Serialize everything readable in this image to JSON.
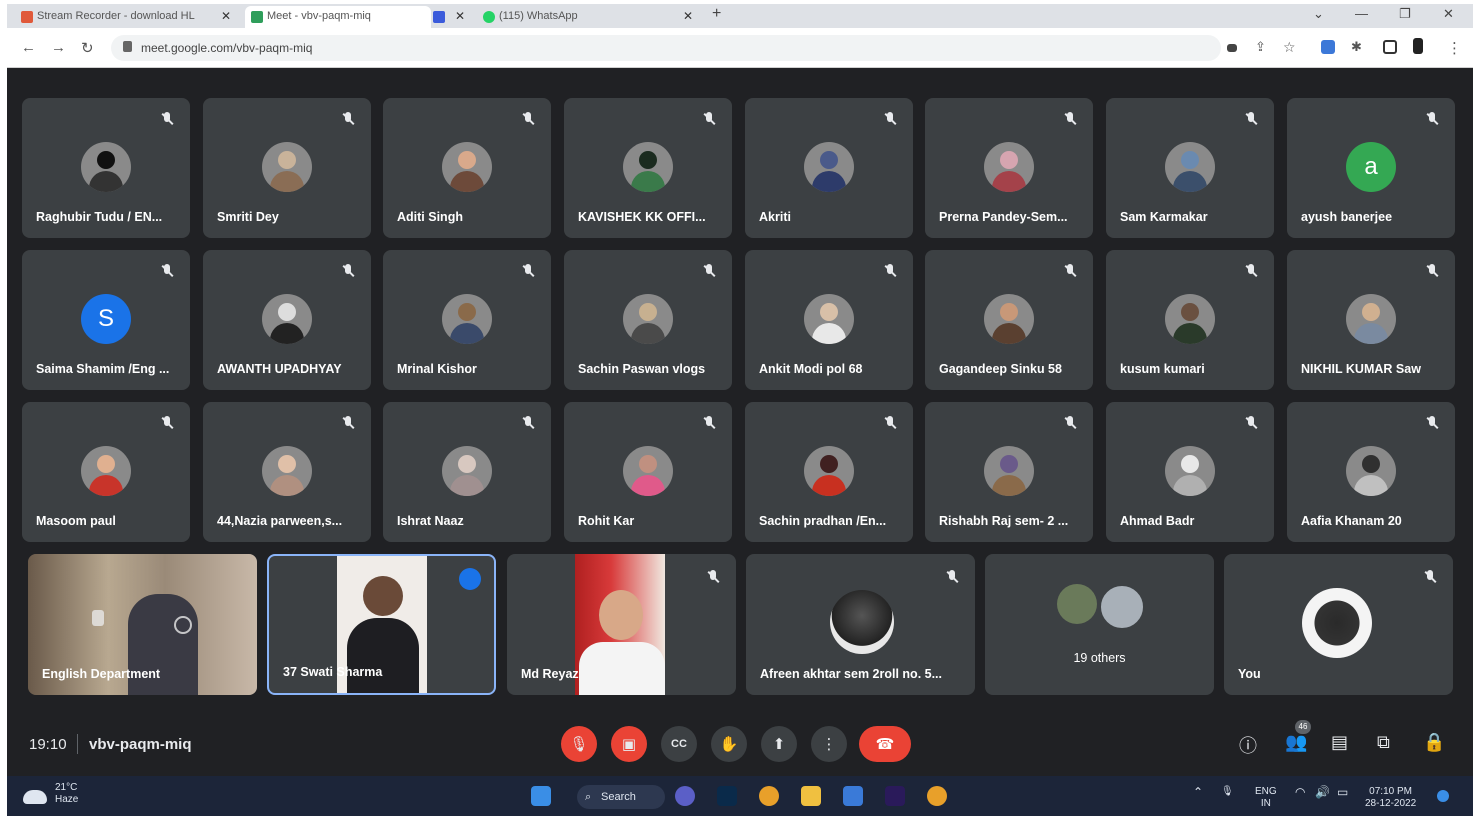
{
  "browser": {
    "tabs": [
      {
        "label": "Stream Recorder - download HL",
        "color": "#e0593a"
      },
      {
        "label": "Meet - vbv-paqm-miq",
        "color": "#2f9e5b"
      },
      {
        "label": "",
        "color": "#3b5bdb"
      },
      {
        "label": "(115) WhatsApp",
        "color": "#25d366"
      }
    ],
    "url": "meet.google.com/vbv-paqm-miq"
  },
  "participants": [
    {
      "name": "Raghubir Tudu / EN...",
      "avatar_color": "#111111",
      "body_color": "#333333"
    },
    {
      "name": "Smriti Dey",
      "avatar_color": "#c9b39a",
      "body_color": "#8a6d55"
    },
    {
      "name": "Aditi Singh",
      "avatar_color": "#d9a98b",
      "body_color": "#6d4a3a"
    },
    {
      "name": "KAVISHEK KK OFFI...",
      "avatar_color": "#1b2b1f",
      "body_color": "#3a7a4a"
    },
    {
      "name": "Akriti",
      "avatar_color": "#4a5a8a",
      "body_color": "#2d3b6a"
    },
    {
      "name": "Prerna Pandey-Sem...",
      "avatar_color": "#d6a5b0",
      "body_color": "#a4424a"
    },
    {
      "name": "Sam Karmakar",
      "avatar_color": "#6a8ab0",
      "body_color": "#3b4f6b"
    },
    {
      "name": "ayush banerjee",
      "letter": "a",
      "avatar_color": "#34a853"
    },
    {
      "name": "Saima Shamim /Eng ...",
      "letter": "S",
      "avatar_color": "#1a73e8"
    },
    {
      "name": "AWANTH UPADHYAY",
      "avatar_color": "#dddddd",
      "body_color": "#222222"
    },
    {
      "name": "Mrinal Kishor",
      "avatar_color": "#8a6a4a",
      "body_color": "#3a4a6a"
    },
    {
      "name": "Sachin Paswan vlogs",
      "avatar_color": "#c7b090",
      "body_color": "#4a4a4a"
    },
    {
      "name": "Ankit Modi pol 68",
      "avatar_color": "#d8c0a8",
      "body_color": "#e8e8e8"
    },
    {
      "name": "Gagandeep Sinku 58",
      "avatar_color": "#c89878",
      "body_color": "#5a4030"
    },
    {
      "name": "kusum kumari",
      "avatar_color": "#6a5040",
      "body_color": "#2a3a2a"
    },
    {
      "name": "NIKHIL KUMAR Saw",
      "avatar_color": "#d0b090",
      "body_color": "#7a8aa0"
    },
    {
      "name": "Masoom paul",
      "avatar_color": "#e0b090",
      "body_color": "#c8342a"
    },
    {
      "name": "44,Nazia parween,s...",
      "avatar_color": "#e0c0a8",
      "body_color": "#b09080"
    },
    {
      "name": "Ishrat Naaz",
      "avatar_color": "#d8c8c0",
      "body_color": "#a09090"
    },
    {
      "name": "Rohit Kar",
      "avatar_color": "#c09080",
      "body_color": "#e05a8a"
    },
    {
      "name": "Sachin pradhan /En...",
      "avatar_color": "#402020",
      "body_color": "#c83020"
    },
    {
      "name": "Rishabh Raj sem- 2 ...",
      "avatar_color": "#6a5a8a",
      "body_color": "#8a6a4a"
    },
    {
      "name": "Ahmad Badr",
      "avatar_color": "#e8e8e8",
      "body_color": "#b0b0b0"
    },
    {
      "name": "Aafia Khanam 20",
      "avatar_color": "#303030",
      "body_color": "#c0c0c0"
    }
  ],
  "featured": [
    {
      "name": "English Department"
    },
    {
      "name": "37 Swati Sharma"
    },
    {
      "name": "Md Reyaz"
    },
    {
      "name": "Afreen akhtar sem 2roll no. 5..."
    },
    {
      "name": "19 others"
    },
    {
      "name": "You"
    }
  ],
  "bottom": {
    "time": "19:10",
    "meeting_code": "vbv-paqm-miq",
    "participant_count": "46"
  },
  "taskbar": {
    "temp": "21°C",
    "weather": "Haze",
    "search": "Search",
    "lang1": "ENG",
    "lang2": "IN",
    "time": "07:10 PM",
    "date": "28-12-2022"
  }
}
